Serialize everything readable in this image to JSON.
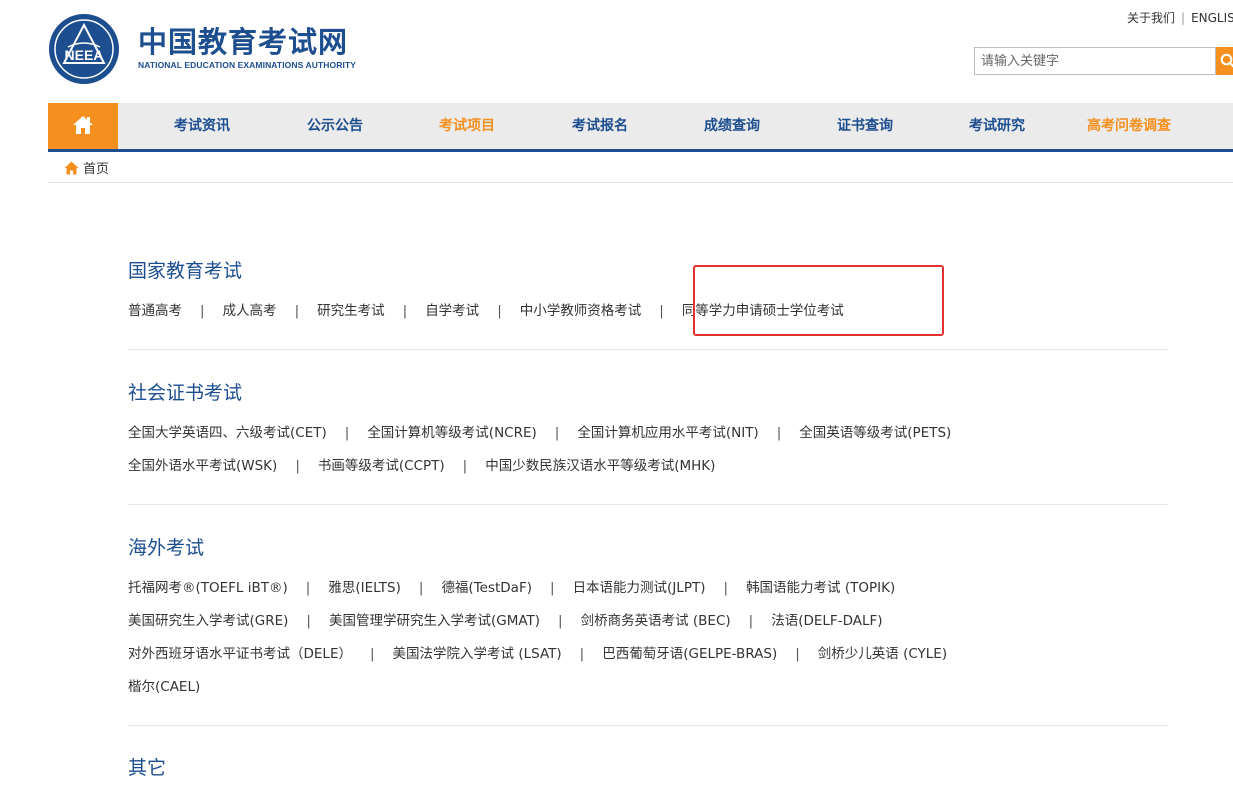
{
  "header": {
    "brand_cn": "中国教育考试网",
    "brand_en": "NATIONAL EDUCATION EXAMINATIONS AUTHORITY",
    "logo_text": "NEEA",
    "about": "关于我们",
    "english": "ENGLISH",
    "separator": "|"
  },
  "search": {
    "placeholder": "请输入关键字"
  },
  "nav": {
    "items": [
      {
        "label": "考试资讯"
      },
      {
        "label": "公示公告"
      },
      {
        "label": "考试项目"
      },
      {
        "label": "考试报名"
      },
      {
        "label": "成绩查询"
      },
      {
        "label": "证书查询"
      },
      {
        "label": "考试研究"
      },
      {
        "label": "高考问卷调查"
      }
    ]
  },
  "breadcrumb": {
    "home": "首页"
  },
  "sections": [
    {
      "title": "国家教育考试",
      "rows": [
        [
          "普通高考",
          "成人高考",
          "研究生考试",
          "自学考试",
          "中小学教师资格考试",
          "同等学力申请硕士学位考试"
        ]
      ]
    },
    {
      "title": "社会证书考试",
      "rows": [
        [
          "全国大学英语四、六级考试(CET)",
          "全国计算机等级考试(NCRE)",
          "全国计算机应用水平考试(NIT)",
          "全国英语等级考试(PETS)"
        ],
        [
          "全国外语水平考试(WSK)",
          "书画等级考试(CCPT)",
          "中国少数民族汉语水平等级考试(MHK)"
        ]
      ]
    },
    {
      "title": "海外考试",
      "rows": [
        [
          "托福网考®(TOEFL iBT®)",
          "雅思(IELTS)",
          "德福(TestDaF)",
          "日本语能力测试(JLPT)",
          "韩国语能力考试 (TOPIK)"
        ],
        [
          "美国研究生入学考试(GRE)",
          "美国管理学研究生入学考试(GMAT)",
          "剑桥商务英语考试 (BEC)",
          "法语(DELF-DALF)"
        ],
        [
          "对外西班牙语水平证书考试（DELE）",
          "美国法学院入学考试 (LSAT)",
          "巴西葡萄牙语(GELPE-BRAS)",
          "剑桥少儿英语 (CYLE)"
        ],
        [
          "楷尔(CAEL)"
        ]
      ]
    },
    {
      "title": "其它",
      "rows": []
    }
  ],
  "colors": {
    "brand_blue": "#1d4e8f",
    "accent_orange": "#f5901e",
    "highlight_red": "#e53030"
  }
}
